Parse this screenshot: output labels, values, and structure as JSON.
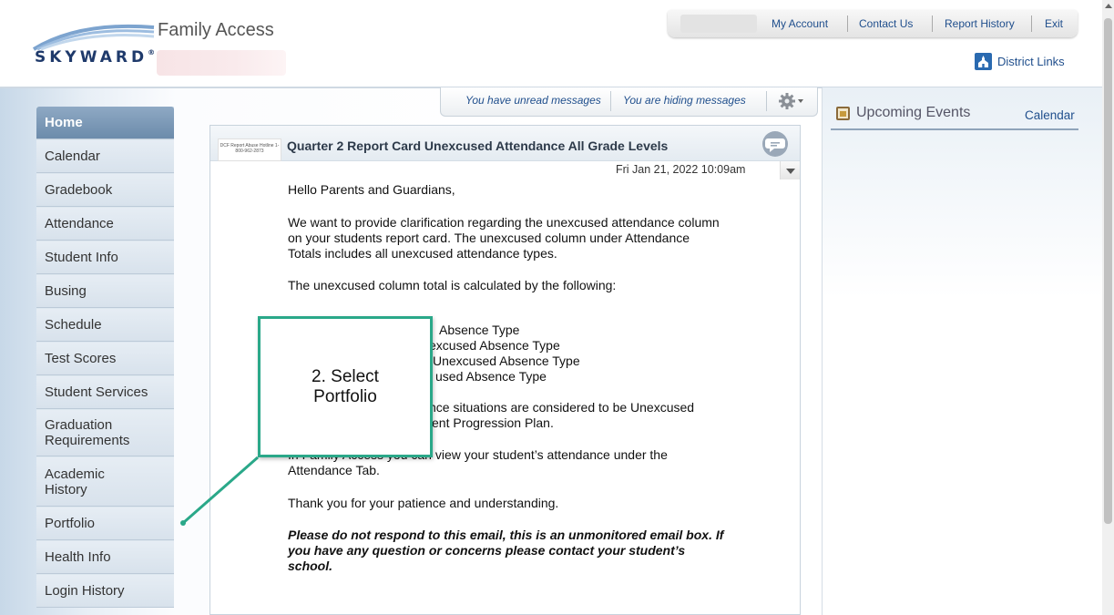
{
  "header": {
    "brand": "SKYWARD",
    "brand_tm": "®",
    "app_title": "Family Access",
    "top_links": [
      "My Account",
      "Contact Us",
      "Report History",
      "Exit"
    ],
    "district_links": "District Links"
  },
  "sidebar": {
    "items": [
      {
        "label": "Home"
      },
      {
        "label": "Calendar"
      },
      {
        "label": "Gradebook"
      },
      {
        "label": "Attendance"
      },
      {
        "label": "Student Info"
      },
      {
        "label": "Busing"
      },
      {
        "label": "Schedule"
      },
      {
        "label": "Test Scores"
      },
      {
        "label": "Student Services"
      },
      {
        "label": "Graduation\nRequirements"
      },
      {
        "label": "Academic\nHistory"
      },
      {
        "label": "Portfolio"
      },
      {
        "label": "Health Info"
      },
      {
        "label": "Login History"
      }
    ],
    "active": "Home"
  },
  "messages_bar": {
    "unread": "You have unread messages",
    "hiding": "You are hiding messages"
  },
  "message": {
    "thumbnail": "DCF Report Abuse Hotline 1-800-962-2873",
    "title": "Quarter 2 Report Card Unexcused Attendance All Grade Levels",
    "date": "Fri Jan 21, 2022 10:09am",
    "lines": [
      "Hello Parents and Guardians,",
      "We want to provide clarification regarding the unexcused attendance column",
      "on your students report card.   The unexcused column under Attendance",
      "Totals includes all unexcused attendance types.",
      "The unexcused column total is calculated by the following:",
      "Absence Type",
      "excused Absence Type",
      "Unexcused Absence Type",
      "used Absence Type",
      "nce situations are considered to be Unexcused",
      "ent Progression Plan.",
      "In Family Access you can view your student’s attendance under the",
      "Attendance Tab.",
      "Thank you for your patience and understanding.",
      "Please do not respond to this email, this is an unmonitored email box.  If",
      "you have any question or concerns please contact your student’s",
      "school."
    ]
  },
  "events": {
    "title": "Upcoming Events",
    "calendar_link": "Calendar"
  },
  "callout": {
    "text": "2. Select\nPortfolio"
  },
  "colors": {
    "accent": "#2aa889",
    "link": "#1f4e8c",
    "nav_active": "#7a97b6"
  }
}
